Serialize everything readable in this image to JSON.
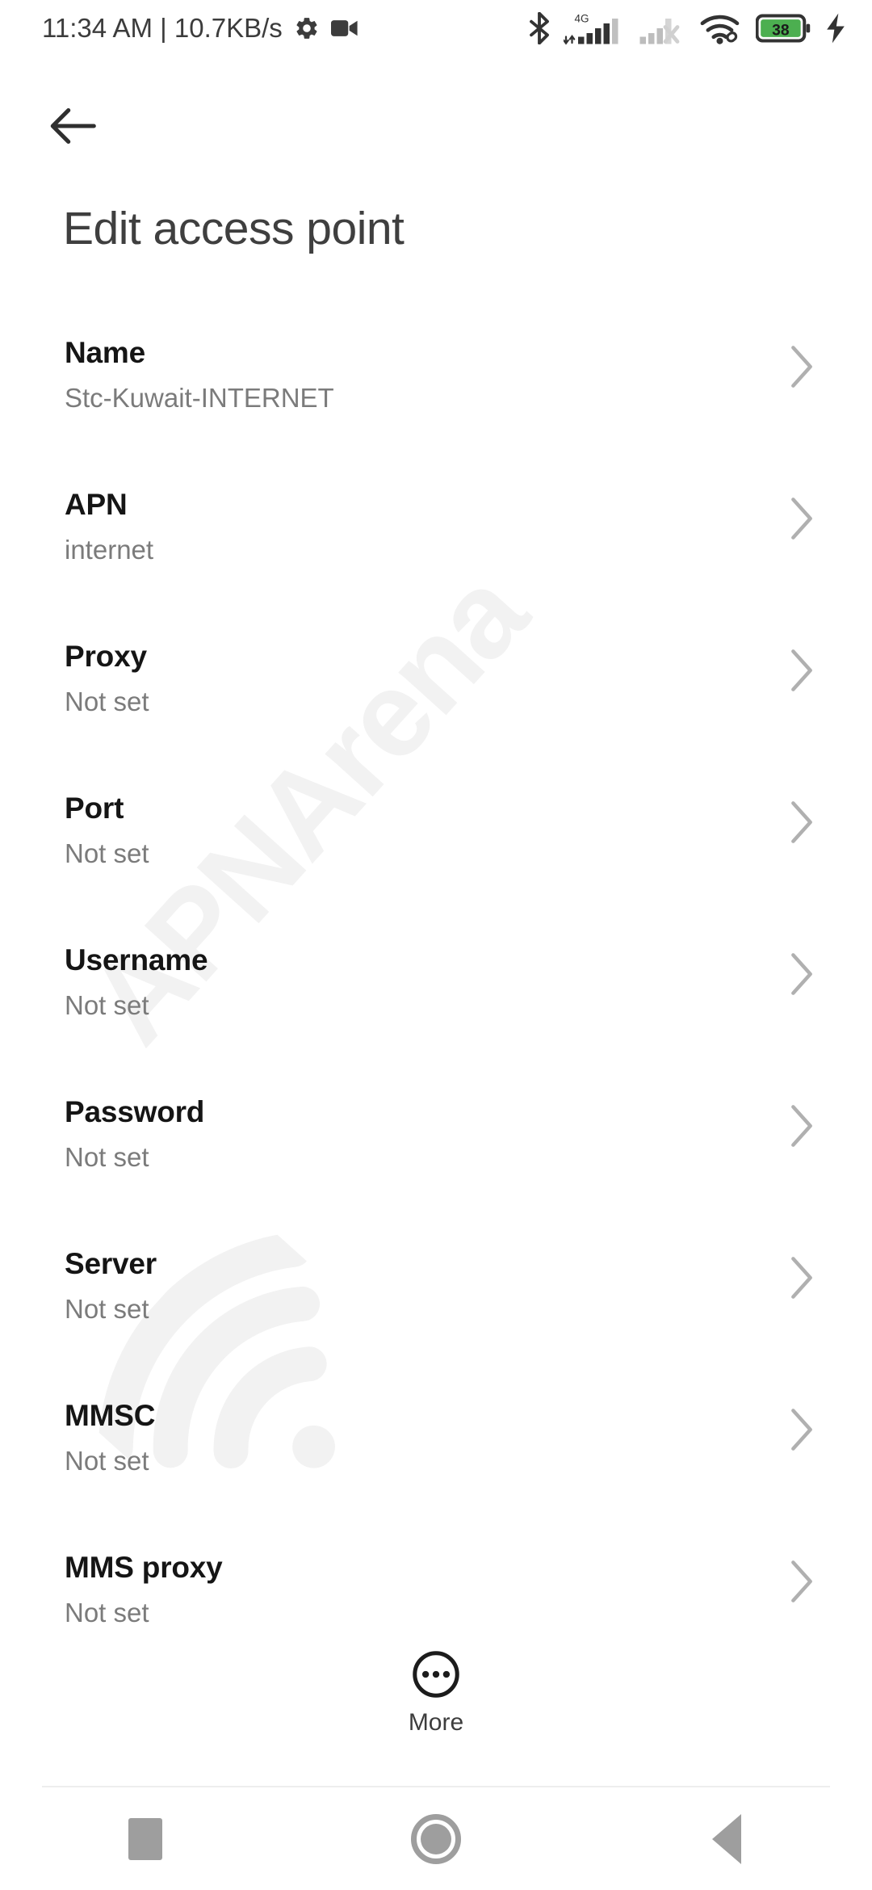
{
  "status_bar": {
    "clock_and_net": "11:34 AM | 10.7KB/s",
    "icons_left": [
      "gear-icon",
      "video-camera-icon"
    ],
    "icons_right": [
      "bluetooth-icon",
      "signal-4g-icon",
      "signal-sim2-no-service-icon",
      "wifi-icon",
      "battery-icon",
      "charging-bolt-icon"
    ],
    "network_type": "4G",
    "battery_percent": "38",
    "battery_color": "#4caf50"
  },
  "app_bar": {
    "back_icon": "arrow-left-icon",
    "title": "Edit access point"
  },
  "list": {
    "chevron_icon": "chevron-right-icon",
    "rows": [
      {
        "title": "Name",
        "value": "Stc-Kuwait-INTERNET"
      },
      {
        "title": "APN",
        "value": "internet"
      },
      {
        "title": "Proxy",
        "value": "Not set"
      },
      {
        "title": "Port",
        "value": "Not set"
      },
      {
        "title": "Username",
        "value": "Not set"
      },
      {
        "title": "Password",
        "value": "Not set"
      },
      {
        "title": "Server",
        "value": "Not set"
      },
      {
        "title": "MMSC",
        "value": "Not set"
      },
      {
        "title": "MMS proxy",
        "value": "Not set"
      }
    ]
  },
  "more_button": {
    "icon": "more-circle-icon",
    "label": "More"
  },
  "nav_bar": {
    "recents_label": "recents-button",
    "home_label": "home-button",
    "back_label": "back-button"
  },
  "watermark": {
    "text": "APNArena",
    "icon": "wifi-signal-icon",
    "color": "#f2f2f2"
  }
}
